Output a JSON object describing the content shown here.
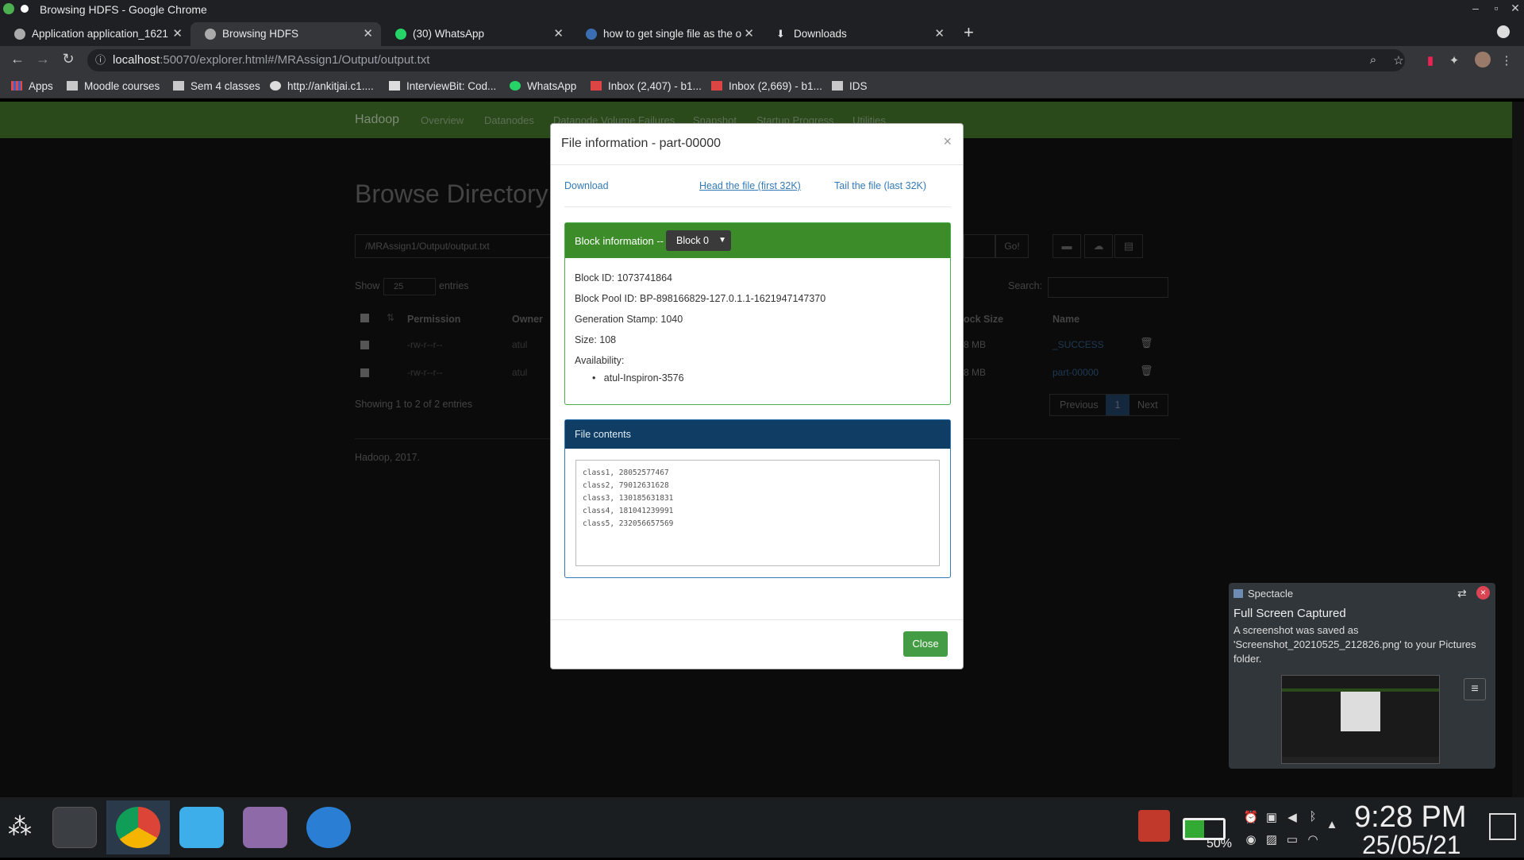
{
  "window": {
    "title": "Browsing HDFS - Google Chrome"
  },
  "tabs": [
    {
      "label": "Application application_1621",
      "active": false
    },
    {
      "label": "Browsing HDFS",
      "active": true
    },
    {
      "label": "(30) WhatsApp",
      "active": false
    },
    {
      "label": "how to get single file as the o",
      "active": false
    },
    {
      "label": "Downloads",
      "active": false
    }
  ],
  "address": {
    "host": "localhost",
    "path": ":50070/explorer.html#/MRAssign1/Output/output.txt"
  },
  "bookmarks": [
    "Apps",
    "Moodle courses",
    "Sem 4 classes",
    "http://ankitjai.c1....",
    "InterviewBit: Cod...",
    "WhatsApp",
    "Inbox (2,407) - b1...",
    "Inbox (2,669) - b1...",
    "IDS"
  ],
  "hadoop": {
    "brand": "Hadoop",
    "nav": [
      "Overview",
      "Datanodes",
      "Datanode Volume Failures",
      "Snapshot",
      "Startup Progress",
      "Utilities"
    ],
    "heading": "Browse Directory",
    "path_value": "/MRAssign1/Output/output.txt",
    "go_label": "Go!",
    "show_label": "Show",
    "show_value": "25",
    "entries_label": "entries",
    "search_label": "Search:",
    "columns": [
      "Permission",
      "Owner",
      "ock Size",
      "Name"
    ],
    "rows": [
      {
        "permission": "-rw-r--r--",
        "owner": "atul",
        "block_size": "8 MB",
        "name": "_SUCCESS"
      },
      {
        "permission": "-rw-r--r--",
        "owner": "atul",
        "block_size": "8 MB",
        "name": "part-00000"
      }
    ],
    "showing": "Showing 1 to 2 of 2 entries",
    "prev": "Previous",
    "page": "1",
    "next": "Next",
    "footer": "Hadoop, 2017."
  },
  "modal": {
    "title": "File information - part-00000",
    "download": "Download",
    "head": "Head the file (first 32K)",
    "tail": "Tail the file (last 32K)",
    "block_label": "Block information --",
    "block_select": "Block 0",
    "block_id": "Block ID: 1073741864",
    "block_pool": "Block Pool ID: BP-898166829-127.0.1.1-1621947147370",
    "gen_stamp": "Generation Stamp: 1040",
    "size": "Size: 108",
    "availability": "Availability:",
    "host": "atul-Inspiron-3576",
    "file_contents_label": "File contents",
    "file_lines": [
      "class1, 28052577467",
      "class2, 79012631628",
      "class3, 130185631831",
      "class4, 181041239991",
      "class5, 232056657569"
    ],
    "close": "Close"
  },
  "notification": {
    "app": "Spectacle",
    "title": "Full Screen Captured",
    "body": "A screenshot was saved as 'Screenshot_20210525_212826.png' to your Pictures folder."
  },
  "taskbar": {
    "time": "9:28 PM",
    "date": "25/05/21",
    "battery": "50%"
  }
}
